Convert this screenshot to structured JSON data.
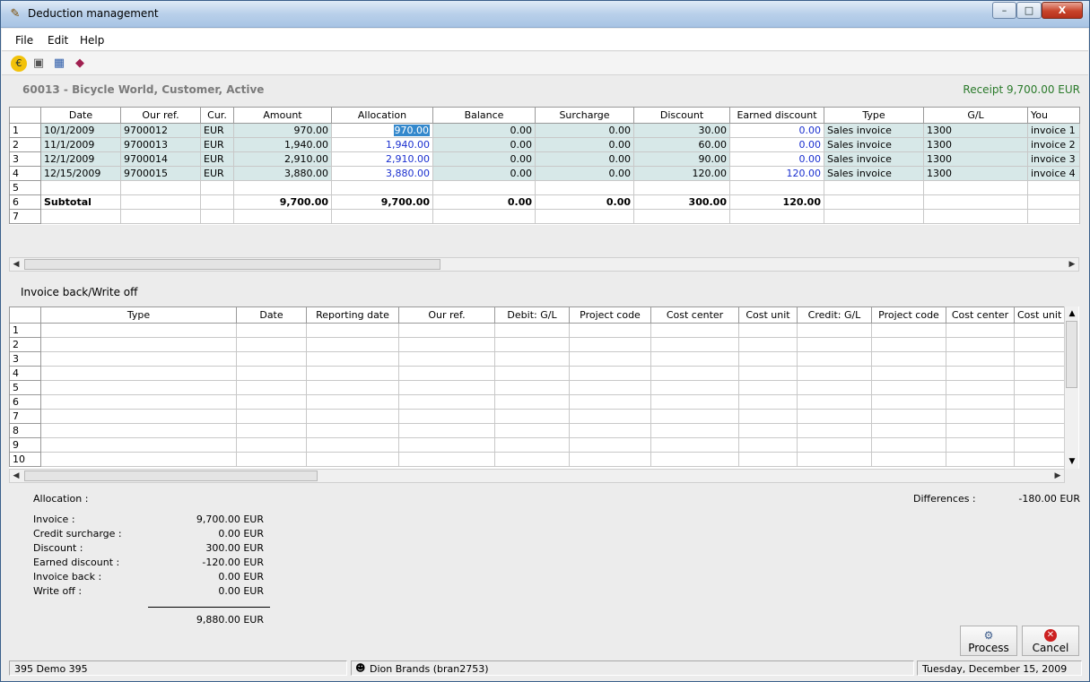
{
  "window": {
    "title": "Deduction management",
    "min": "–",
    "max": "□",
    "close": "X"
  },
  "menu": [
    "File",
    "Edit",
    "Help"
  ],
  "toolbar": {
    "icons": [
      "euro-coin-icon",
      "camera-icon",
      "table-icon",
      "book-icon"
    ]
  },
  "header": {
    "customer": "60013 - Bicycle World, Customer, Active",
    "receipt": "Receipt 9,700.00 EUR"
  },
  "grid1": {
    "columns": [
      "Date",
      "Our ref.",
      "Cur.",
      "Amount",
      "Allocation",
      "Balance",
      "Surcharge",
      "Discount",
      "Earned discount",
      "Type",
      "G/L",
      "You"
    ],
    "rows": [
      [
        "10/1/2009",
        "9700012",
        "EUR",
        "970.00",
        "970.00",
        "0.00",
        "0.00",
        "30.00",
        "0.00",
        "Sales invoice",
        "1300",
        "invoice 1"
      ],
      [
        "11/1/2009",
        "9700013",
        "EUR",
        "1,940.00",
        "1,940.00",
        "0.00",
        "0.00",
        "60.00",
        "0.00",
        "Sales invoice",
        "1300",
        "invoice 2"
      ],
      [
        "12/1/2009",
        "9700014",
        "EUR",
        "2,910.00",
        "2,910.00",
        "0.00",
        "0.00",
        "90.00",
        "0.00",
        "Sales invoice",
        "1300",
        "invoice 3"
      ],
      [
        "12/15/2009",
        "9700015",
        "EUR",
        "3,880.00",
        "3,880.00",
        "0.00",
        "0.00",
        "120.00",
        "120.00",
        "Sales invoice",
        "1300",
        "invoice 4"
      ],
      [
        "",
        "",
        "",
        "",
        "",
        "",
        "",
        "",
        "",
        "",
        "",
        ""
      ],
      [
        "Subtotal",
        "",
        "",
        "9,700.00",
        "9,700.00",
        "0.00",
        "0.00",
        "300.00",
        "120.00",
        "",
        "",
        ""
      ],
      [
        "",
        "",
        "",
        "",
        "",
        "",
        "",
        "",
        "",
        "",
        "",
        ""
      ]
    ]
  },
  "invoice_back_label": "Invoice back/Write off",
  "grid2": {
    "columns": [
      "Type",
      "Date",
      "Reporting date",
      "Our ref.",
      "Debit: G/L",
      "Project code",
      "Cost center",
      "Cost unit",
      "Credit: G/L",
      "Project code",
      "Cost center",
      "Cost unit"
    ],
    "row_numbers": [
      "1",
      "2",
      "3",
      "4",
      "5",
      "6",
      "7",
      "8",
      "9",
      "10"
    ]
  },
  "summary": {
    "allocation_label": "Allocation :",
    "differences_label": "Differences :",
    "differences_value": "-180.00 EUR",
    "lines": [
      {
        "label": "Invoice :",
        "value": "9,700.00 EUR"
      },
      {
        "label": "Credit surcharge :",
        "value": "0.00 EUR"
      },
      {
        "label": "Discount :",
        "value": "300.00 EUR"
      },
      {
        "label": "Earned discount :",
        "value": "-120.00 EUR"
      },
      {
        "label": "Invoice back :",
        "value": "0.00 EUR"
      },
      {
        "label": "Write off :",
        "value": "0.00 EUR"
      }
    ],
    "total": "9,880.00 EUR"
  },
  "buttons": {
    "process": "Process",
    "cancel": "Cancel"
  },
  "status": {
    "company": "395 Demo 395",
    "user": "Dion Brands (bran2753)",
    "date": "Tuesday, December 15, 2009"
  }
}
